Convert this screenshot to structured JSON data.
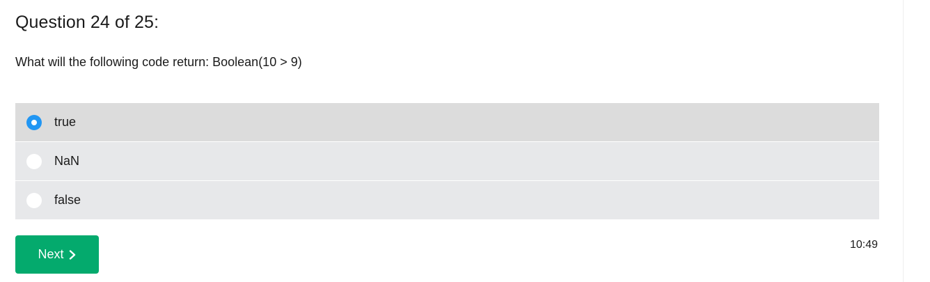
{
  "quiz": {
    "title": "Question 24 of 25:",
    "question": "What will the following code return: Boolean(10 > 9)",
    "options": [
      {
        "label": "true",
        "selected": true
      },
      {
        "label": "NaN",
        "selected": false
      },
      {
        "label": "false",
        "selected": false
      }
    ],
    "next_label": "Next",
    "timer": "10:49"
  },
  "colors": {
    "accent_radio": "#2196f3",
    "next_button": "#04aa6d",
    "option_bg": "#e7e8ea",
    "option_selected_bg": "#dcdcdc"
  },
  "icons": {
    "next_chevron": "chevron-right-icon"
  }
}
